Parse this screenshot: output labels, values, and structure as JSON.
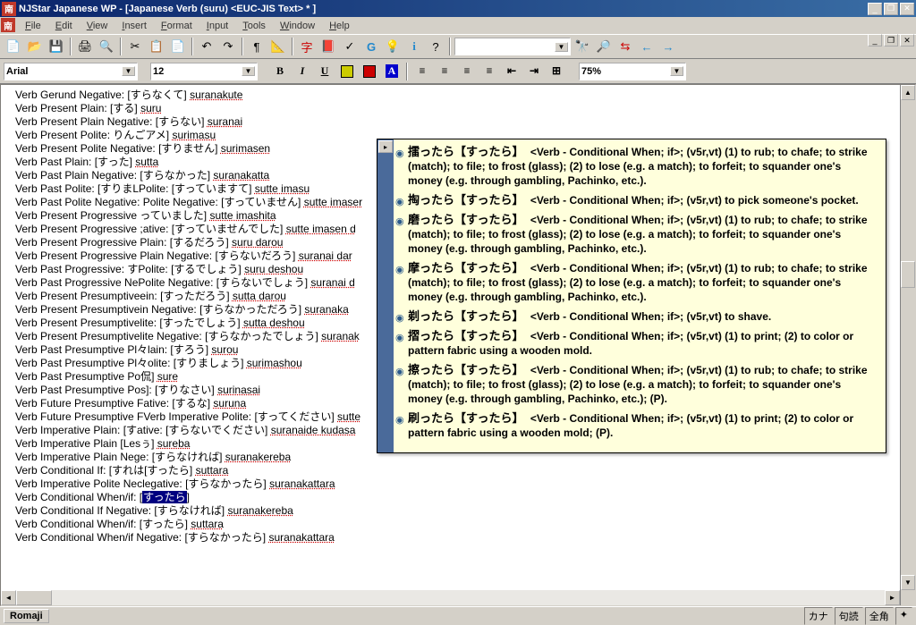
{
  "window": {
    "title": "NJStar Japanese WP - [Japanese Verb (suru) <EUC-JIS Text> * ]",
    "app_icon_char": "南"
  },
  "menubar": {
    "items": [
      "File",
      "Edit",
      "View",
      "Insert",
      "Format",
      "Input",
      "Tools",
      "Window",
      "Help"
    ]
  },
  "toolbar_combo_placeholder": "",
  "formatbar": {
    "font": "Arial",
    "size": "12",
    "zoom": "75%",
    "buttons": [
      "B",
      "I",
      "U"
    ]
  },
  "document_lines": [
    {
      "label": "Verb Gerund Negative:",
      "jp": "[すらなくて]",
      "romaji": "suranakute"
    },
    {
      "label": "Verb Present Plain:",
      "jp": "[する]",
      "romaji": "suru"
    },
    {
      "label": "Verb Present Plain Negative:",
      "jp": "[すらない]",
      "romaji": "suranai"
    },
    {
      "label": "Verb Present Polite:",
      "jp": "りんごアメ]",
      "romaji": "surimasu"
    },
    {
      "label": "Verb Present Polite Negative:",
      "jp": "[すりません]",
      "romaji": "surimasen"
    },
    {
      "label": "Verb Past Plain:",
      "jp": "[すった]",
      "romaji": "sutta"
    },
    {
      "label": "Verb Past Plain Negative:",
      "jp": "[すらなかった]",
      "romaji": "suranakatta"
    },
    {
      "label": "Verb Past Polite:",
      "jp": "[すりまLPolite: [すっていますて]",
      "romaji": "sutte imasu"
    },
    {
      "label": "Verb Past Polite Negative: Polite Negative:",
      "jp": "[すっていません]",
      "romaji": "sutte imaser"
    },
    {
      "label": "Verb Present Progressive っていました]",
      "jp": "",
      "romaji": "sutte imashita"
    },
    {
      "label": "Verb Present Progressive ;ative:",
      "jp": "[すっていませんでした]",
      "romaji": "sutte imasen d"
    },
    {
      "label": "Verb Present Progressive Plain:",
      "jp": "[するだろう]",
      "romaji": "suru darou"
    },
    {
      "label": "Verb Present Progressive Plain Negative:",
      "jp": "[すらないだろう]",
      "romaji": "suranai dar"
    },
    {
      "label": "Verb Past Progressive: すPolite:",
      "jp": "[するでしょう]",
      "romaji": "suru deshou"
    },
    {
      "label": "Verb Past Progressive NePolite Negative:",
      "jp": "[すらないでしょう]",
      "romaji": "suranai d"
    },
    {
      "label": "Verb Present Presumptiveein:",
      "jp": "[すっただろう]",
      "romaji": "sutta darou"
    },
    {
      "label": "Verb Present Presumptivein Negative:",
      "jp": "[すらなかっただろう]",
      "romaji": "suranaka"
    },
    {
      "label": "Verb Present Presumptivelite:",
      "jp": "[すったでしょう]",
      "romaji": "sutta deshou"
    },
    {
      "label": "Verb Present Presumptivelite Negative:",
      "jp": "[すらなかったでしょう]",
      "romaji": "suranak"
    },
    {
      "label": "Verb Past Presumptive Pl々lain:",
      "jp": "[すろう]",
      "romaji": "surou"
    },
    {
      "label": "Verb Past Presumptive Pl々olite:",
      "jp": "[すりましょう]",
      "romaji": "surimashou"
    },
    {
      "label": "Verb Past Presumptive Po侃]",
      "jp": "",
      "romaji": "sure"
    },
    {
      "label": "Verb Past Presumptive Pos]:",
      "jp": "[すりなさい]",
      "romaji": "surinasai"
    },
    {
      "label": "Verb Future Presumptive Fative:",
      "jp": "[するな]",
      "romaji": "suruna"
    },
    {
      "label": "Verb Future Presumptive FVerb Imperative Polite:",
      "jp": "[すってください]",
      "romaji": "sutte"
    },
    {
      "label": "Verb Imperative Plain:",
      "jp": "[すative: [すらないでください]",
      "romaji": "suranaide kudasa"
    },
    {
      "label": "Verb Imperative Plain [Lesぅ]",
      "jp": "",
      "romaji": "sureba"
    },
    {
      "label": "Verb Imperative Plain Nege:",
      "jp": "[すらなければ]",
      "romaji": "suranakereba"
    },
    {
      "label": "Verb Conditional If:",
      "jp": "[すれは[すったら]",
      "romaji": "suttara"
    },
    {
      "label": "Verb Imperative Polite Neclegative:",
      "jp": "[すらなかったら]",
      "romaji": "suranakattara"
    },
    {
      "label": "Verb Conditional When/if:",
      "jp": "",
      "romaji": "",
      "highlighted": "すったら"
    },
    {
      "label": "Verb Conditional If Negative:",
      "jp": "[すらなければ]",
      "romaji": "suranakereba"
    },
    {
      "label": "Verb Conditional When/if:",
      "jp": "[すったら]",
      "romaji": "suttara"
    },
    {
      "label": "Verb Conditional When/if Negative:",
      "jp": "[すらなかったら]",
      "romaji": "suranakattara"
    }
  ],
  "tooltip": {
    "entries": [
      {
        "jp": "擂ったら【すったら】",
        "def": "<Verb - Conditional When; if>; (v5r,vt) (1) to rub; to chafe; to strike (match); to file; to frost (glass); (2) to lose (e.g. a match); to forfeit; to squander one's money (e.g. through gambling, Pachinko, etc.)."
      },
      {
        "jp": "掏ったら【すったら】",
        "def": "<Verb - Conditional When; if>; (v5r,vt) to pick someone's pocket."
      },
      {
        "jp": "磨ったら【すったら】",
        "def": "<Verb - Conditional When; if>; (v5r,vt) (1) to rub; to chafe; to strike (match); to file; to frost (glass); (2) to lose (e.g. a match); to forfeit; to squander one's money (e.g. through gambling, Pachinko, etc.)."
      },
      {
        "jp": "摩ったら【すったら】",
        "def": "<Verb - Conditional When; if>; (v5r,vt) (1) to rub; to chafe; to strike (match); to file; to frost (glass); (2) to lose (e.g. a match); to forfeit; to squander one's money (e.g. through gambling, Pachinko, etc.)."
      },
      {
        "jp": "剃ったら【すったら】",
        "def": "<Verb - Conditional When; if>; (v5r,vt) to shave."
      },
      {
        "jp": "摺ったら【すったら】",
        "def": "<Verb - Conditional When; if>; (v5r,vt) (1) to print; (2) to color or pattern fabric using a wooden mold."
      },
      {
        "jp": "擦ったら【すったら】",
        "def": "<Verb - Conditional When; if>; (v5r,vt) (1) to rub; to chafe; to strike (match); to file; to frost (glass); (2) to lose (e.g. a match); to forfeit; to squander one's money (e.g. through gambling, Pachinko, etc.); (P)."
      },
      {
        "jp": "刷ったら【すったら】",
        "def": "<Verb - Conditional When; if>; (v5r,vt) (1) to print; (2) to color or pattern fabric using a wooden mold; (P)."
      }
    ]
  },
  "statusbar": {
    "left_button": "Romaji",
    "right_items": [
      "カナ",
      "句読",
      "全角",
      "✦"
    ]
  }
}
